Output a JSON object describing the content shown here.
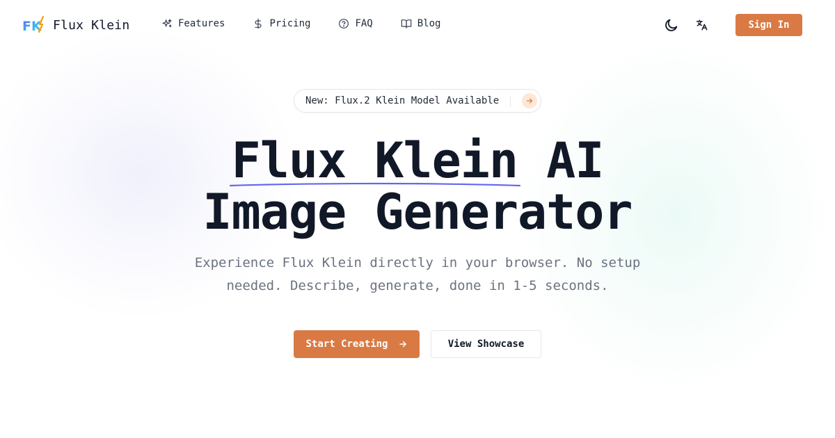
{
  "brand": {
    "logo_text": "FK",
    "name": "Flux Klein"
  },
  "nav": {
    "links": [
      {
        "label": "Features",
        "icon": "sparkles-icon"
      },
      {
        "label": "Pricing",
        "icon": "dollar-icon"
      },
      {
        "label": "FAQ",
        "icon": "question-circle-icon"
      },
      {
        "label": "Blog",
        "icon": "book-open-icon"
      }
    ],
    "theme_icon": "moon-icon",
    "language_icon": "translate-icon",
    "signin_label": "Sign In"
  },
  "announcement": {
    "text": "New: Flux.2 Klein Model Available",
    "icon": "arrow-right-icon"
  },
  "hero": {
    "title_line1_accent": "Flux Klein",
    "title_line1_rest": " AI",
    "title_line2": "Image Generator",
    "subtitle": "Experience Flux Klein directly in your browser. No setup needed. Describe, generate, done in 1-5 seconds.",
    "primary_cta": "Start Creating",
    "secondary_cta": "View Showcase"
  },
  "colors": {
    "accent": "#d97a45",
    "underline": "#6366f1",
    "text": "#111827",
    "muted": "#6b7280"
  }
}
